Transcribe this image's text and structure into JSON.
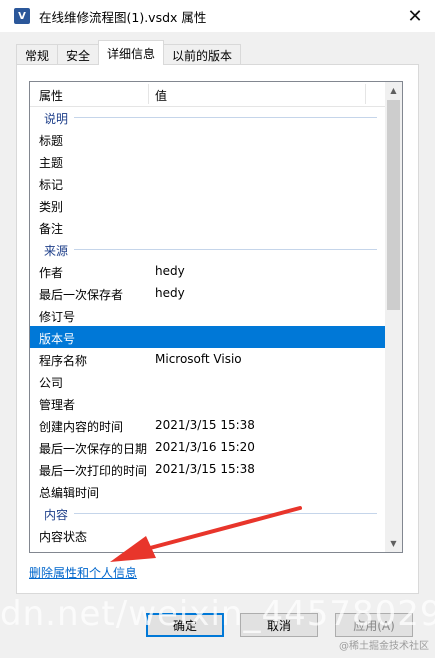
{
  "window": {
    "icon_label": "V",
    "title": "在线维修流程图(1).vsdx 属性",
    "close_glyph": "✕"
  },
  "tabs": [
    {
      "label": "常规",
      "active": false
    },
    {
      "label": "安全",
      "active": false
    },
    {
      "label": "详细信息",
      "active": true
    },
    {
      "label": "以前的版本",
      "active": false
    }
  ],
  "list": {
    "col_property": "属性",
    "col_value": "值",
    "groups": {
      "description": "说明",
      "origin": "来源",
      "content": "内容"
    },
    "description_rows": [
      {
        "name": "标题",
        "value": ""
      },
      {
        "name": "主题",
        "value": ""
      },
      {
        "name": "标记",
        "value": ""
      },
      {
        "name": "类别",
        "value": ""
      },
      {
        "name": "备注",
        "value": ""
      }
    ],
    "origin_rows": [
      {
        "name": "作者",
        "value": "hedy"
      },
      {
        "name": "最后一次保存者",
        "value": "hedy"
      },
      {
        "name": "修订号",
        "value": ""
      },
      {
        "name": "版本号",
        "value": "",
        "selected": true
      },
      {
        "name": "程序名称",
        "value": "Microsoft Visio"
      },
      {
        "name": "公司",
        "value": ""
      },
      {
        "name": "管理者",
        "value": ""
      },
      {
        "name": "创建内容的时间",
        "value": "2021/3/15 15:38"
      },
      {
        "name": "最后一次保存的日期",
        "value": "2021/3/16 15:20"
      },
      {
        "name": "最后一次打印的时间",
        "value": "2021/3/15 15:38"
      },
      {
        "name": "总编辑时间",
        "value": ""
      }
    ],
    "content_rows": [
      {
        "name": "内容状态",
        "value": ""
      }
    ]
  },
  "remove_link": "删除属性和个人信息",
  "buttons": {
    "ok": "确定",
    "cancel": "取消",
    "apply": "应用(A)"
  },
  "watermark": "dn.net/weixin_44578029",
  "watermark_small": "@稀土掘金技术社区",
  "colors": {
    "selection": "#0078d7",
    "link": "#0066cc",
    "arrow": "#e8352b"
  }
}
